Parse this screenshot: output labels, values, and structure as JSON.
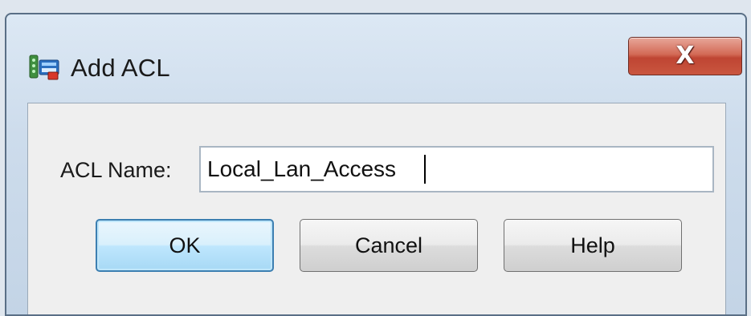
{
  "window": {
    "title": "Add ACL",
    "icon": "network-acl-icon",
    "close_glyph": "X"
  },
  "form": {
    "acl_name_label": "ACL Name:",
    "acl_name_value": "Local_Lan_Access"
  },
  "buttons": {
    "ok_label": "OK",
    "cancel_label": "Cancel",
    "help_label": "Help"
  },
  "colors": {
    "close_button": "#c9563f",
    "default_button_border": "#3c7fb1"
  }
}
